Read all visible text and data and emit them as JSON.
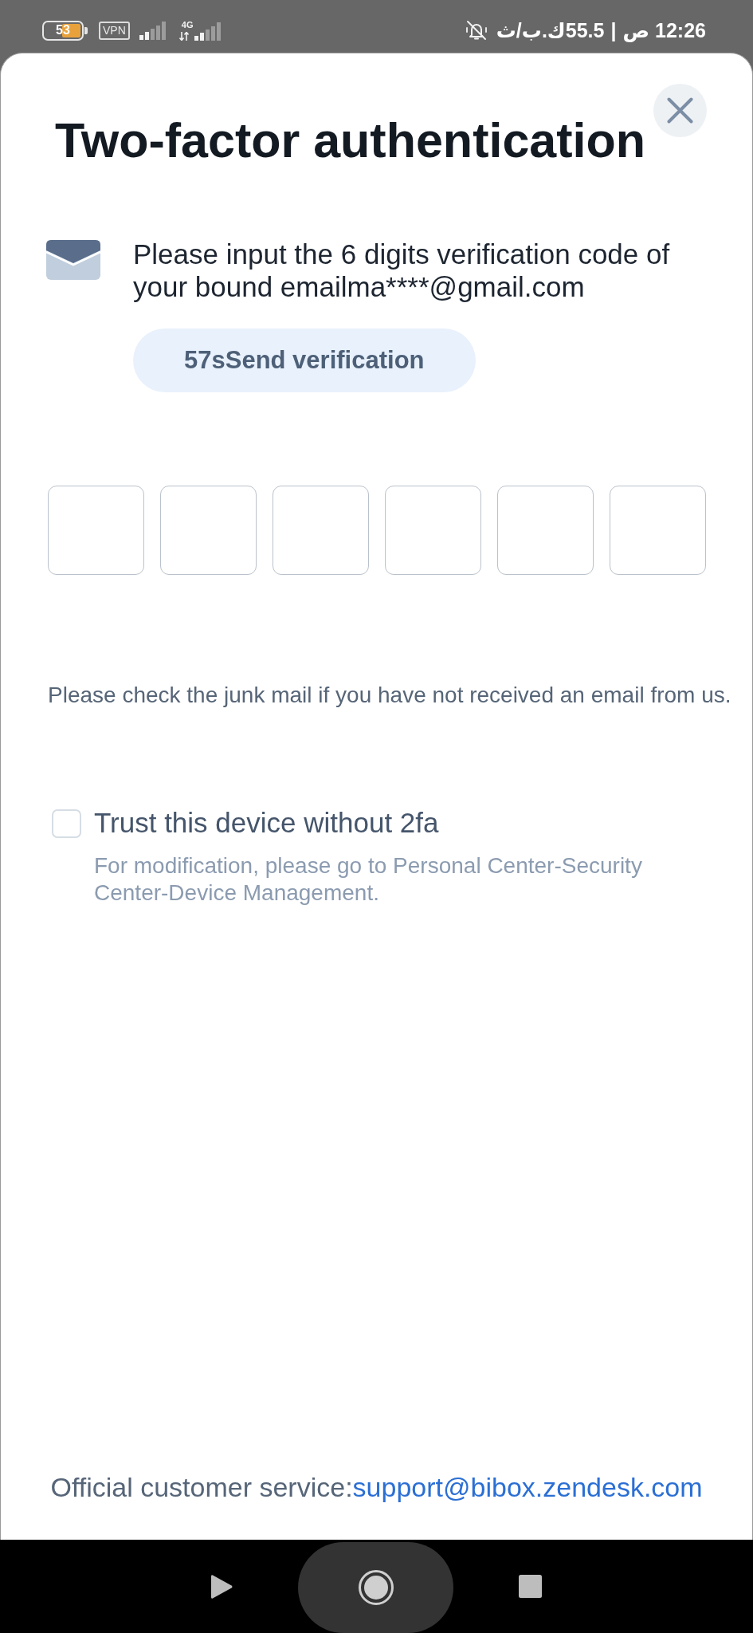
{
  "status_bar": {
    "battery": {
      "text": "53",
      "level": 0.53
    },
    "vpn": "VPN",
    "network": "4G",
    "clock": "12:26 ص",
    "separator": "|",
    "speed": "55.5ك.ب/ث"
  },
  "header": {
    "title": "Two-factor authentication"
  },
  "email_prompt": {
    "message": "Please input the 6 digits verification code of your bound emailma****@gmail.com",
    "send_button": "57sSend verification"
  },
  "code_fields": [
    {
      "focused": false
    },
    {
      "focused": false
    },
    {
      "focused": false
    },
    {
      "focused": false
    },
    {
      "focused": false
    },
    {
      "focused": false
    }
  ],
  "junk_note": "Please check the junk mail if you have not received an email from us.",
  "trust_device": {
    "label": "Trust this device without 2fa",
    "checked": false,
    "note": "For modification, please go to Personal Center-Security Center-Device Management."
  },
  "footer": {
    "label": "Official customer service:",
    "link": "support@bibox.zendesk.com"
  }
}
